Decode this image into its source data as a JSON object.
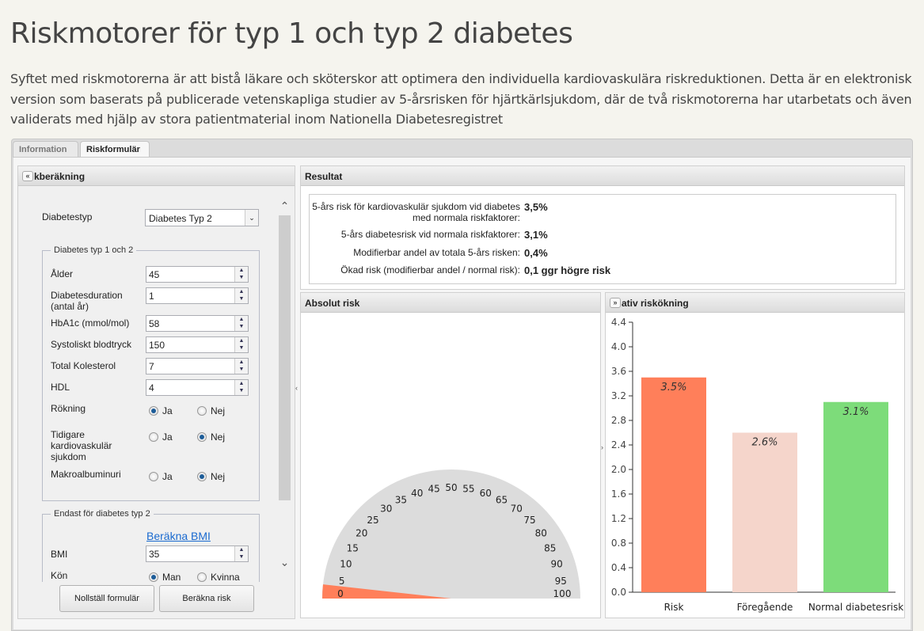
{
  "page": {
    "title": "Riskmotorer för typ 1 och typ 2 diabetes",
    "intro": "Syftet med riskmotorerna är att bistå läkare och sköterskor att optimera den individuella kardiovaskulära riskreduktionen. Detta är en elektronisk version som baserats på publicerade vetenskapliga studier av 5-årsrisken för hjärtkärlsjukdom, där de två riskmotorerna har utarbetats och även validerats med hjälp av stora patientmaterial inom Nationella Diabetesregistret"
  },
  "tabs": [
    {
      "label": "Information",
      "active": false
    },
    {
      "label": "Riskformulär",
      "active": true
    }
  ],
  "form": {
    "header": "kberäkning",
    "collapse_icon": "double-chevron-left",
    "diabetestyp_label": "Diabetestyp",
    "diabetestyp_value": "Diabetes Typ 2",
    "group1": "Diabetes typ 1 och 2",
    "fields": [
      {
        "label": "Ålder",
        "value": "45"
      },
      {
        "label": "Diabetesduration (antal år)",
        "value": "1"
      },
      {
        "label": "HbA1c (mmol/mol)",
        "value": "58"
      },
      {
        "label": "Systoliskt blodtryck",
        "value": "150"
      },
      {
        "label": "Total Kolesterol",
        "value": "7"
      },
      {
        "label": "HDL",
        "value": "4"
      }
    ],
    "radios": [
      {
        "label": "Rökning",
        "yes": "Ja",
        "no": "Nej",
        "selected": "Ja"
      },
      {
        "label": "Tidigare kardiovaskulär sjukdom",
        "yes": "Ja",
        "no": "Nej",
        "selected": "Nej"
      },
      {
        "label": "Makroalbuminuri",
        "yes": "Ja",
        "no": "Nej",
        "selected": "Nej"
      }
    ],
    "group2": "Endast för diabetes typ 2",
    "bmi_link": "Beräkna BMI",
    "bmi_label": "BMI",
    "bmi_value": "35",
    "kon_label": "Kön",
    "kon_man": "Man",
    "kon_kvinna": "Kvinna",
    "kon_selected": "Man",
    "reset_label": "Nollställ formulär",
    "calc_label": "Beräkna risk"
  },
  "result": {
    "header": "Resultat",
    "rows": [
      {
        "label": "5-års risk för kardiovaskulär sjukdom vid diabetes med normala riskfaktorer:",
        "value": "3,5%"
      },
      {
        "label": "5-års diabetesrisk vid normala riskfaktorer:",
        "value": "3,1%"
      },
      {
        "label": "Modifierbar andel av totala 5-års risken:",
        "value": "0,4%"
      },
      {
        "label": "Ökad risk (modifierbar andel / normal risk):",
        "value": "0,1 ggr högre risk"
      }
    ]
  },
  "gauge": {
    "header": "Absolut risk",
    "value": 3.5,
    "min": 0,
    "max": 100,
    "ticks": [
      0,
      5,
      10,
      15,
      20,
      25,
      30,
      35,
      40,
      45,
      50,
      55,
      60,
      65,
      70,
      75,
      80,
      85,
      90,
      95,
      100
    ],
    "fill_color": "#ff7f5a",
    "track_color": "#dcdcdc"
  },
  "chart_data": {
    "type": "bar",
    "title": "ativ riskökning",
    "expand_icon": "double-chevron-right",
    "categories": [
      "Risk",
      "Föregående",
      "Normal diabetesrisk"
    ],
    "values": [
      3.5,
      2.6,
      3.1
    ],
    "data_labels": [
      "3.5%",
      "2.6%",
      "3.1%"
    ],
    "colors": [
      "#ff7f5a",
      "#f5d5cb",
      "#7ddc7a"
    ],
    "yticks": [
      "0.0",
      "0.4",
      "0.8",
      "1.2",
      "1.6",
      "2.0",
      "2.4",
      "2.8",
      "3.2",
      "3.6",
      "4.0",
      "4.4"
    ],
    "ylim": [
      0,
      4.4
    ],
    "grid": false
  }
}
